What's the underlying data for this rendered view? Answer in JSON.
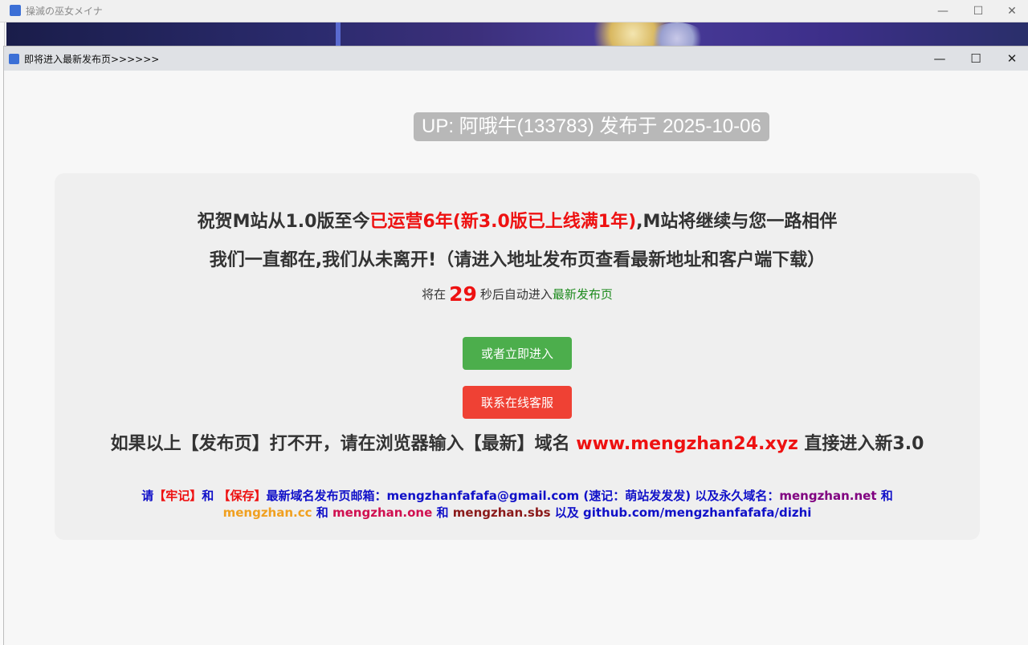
{
  "background_window": {
    "title": "操滅の巫女メイナ",
    "controls": {
      "minimize": "—",
      "maximize": "☐",
      "close": "✕"
    }
  },
  "dialog": {
    "title": "即将进入最新发布页>>>>>>",
    "controls": {
      "minimize": "—",
      "maximize": "☐",
      "close": "✕"
    }
  },
  "up_badge": "UP: 阿哦牛(133783) 发布于 2025-10-06",
  "headline1": {
    "part1": "祝贺M站从1.0版至今",
    "part2_red": "已运营6年(新3.0版已上线满1年)",
    "part3": ",M站将继续与您一路相伴"
  },
  "headline2": "我们一直都在,我们从未离开!（请进入地址发布页查看最新地址和客户端下载）",
  "countdown": {
    "prefix": "将在",
    "seconds": "29",
    "suffix": "秒后自动进入",
    "link": "最新发布页"
  },
  "buttons": {
    "enter_now": "或者立即进入",
    "contact_service": "联系在线客服"
  },
  "domain_notice": {
    "prefix": "如果以上【发布页】打不开，请在浏览器输入【最新】域名",
    "domain": "www.mengzhan24.xyz",
    "suffix": "直接进入新3.0"
  },
  "mail_notice": {
    "p1": "请",
    "remember": "【牢记】",
    "and1": "和",
    "save": "【保存】",
    "p2": "最新域名发布页邮箱：mengzhanfafafa@gmail.com (速记：萌站发发发) 以及永久域名：",
    "domain_net": "mengzhan.net",
    "and2": "和",
    "domain_cc": "mengzhan.cc",
    "and3": "和",
    "domain_one": "mengzhan.one",
    "and4": "和",
    "domain_sbs": "mengzhan.sbs",
    "p3": "以及 github.com/mengzhanfafafa/dizhi"
  },
  "colors": {
    "accent_red": "#ee1111",
    "button_green": "#4cae4c",
    "button_red": "#ef4134",
    "mail_blue": "#1010c8"
  }
}
